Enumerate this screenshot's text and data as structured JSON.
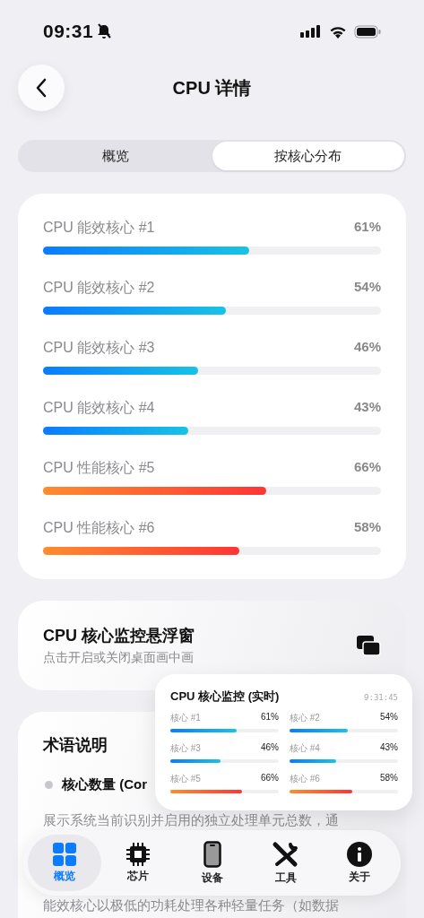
{
  "status_bar": {
    "time": "09:31"
  },
  "header": {
    "title": "CPU 详情"
  },
  "tabs": [
    {
      "label": "概览",
      "selected": false
    },
    {
      "label": "按核心分布",
      "selected": true
    }
  ],
  "cores": [
    {
      "name": "CPU 能效核心 #1",
      "reading": "61%",
      "level": 0.61,
      "kind": "efficiency"
    },
    {
      "name": "CPU 能效核心 #2",
      "reading": "54%",
      "level": 0.54,
      "kind": "efficiency"
    },
    {
      "name": "CPU 能效核心 #3",
      "reading": "46%",
      "level": 0.46,
      "kind": "efficiency"
    },
    {
      "name": "CPU 能效核心 #4",
      "reading": "43%",
      "level": 0.43,
      "kind": "efficiency"
    },
    {
      "name": "CPU 性能核心 #5",
      "reading": "66%",
      "level": 0.66,
      "kind": "performance"
    },
    {
      "name": "CPU 性能核心 #6",
      "reading": "58%",
      "level": 0.58,
      "kind": "performance"
    }
  ],
  "floating_window_card": {
    "title": "CPU 核心监控悬浮窗",
    "subtitle": "点击开启或关闭桌面画中画"
  },
  "glossary": {
    "title": "术语说明",
    "term": "核心数量 (Cor",
    "paragraph": "展示系统当前识别并启用的独立处理单元总数，通",
    "paragraph_2": "能效核心以极低的功耗处理各种轻量任务（如数据"
  },
  "monitor": {
    "title": "CPU 核心监控 (实时)",
    "time": "9:31:45",
    "cores": [
      {
        "name": "核心 #1",
        "reading": "61%",
        "level": 0.61,
        "kind": "efficiency"
      },
      {
        "name": "核心 #2",
        "reading": "54%",
        "level": 0.54,
        "kind": "efficiency"
      },
      {
        "name": "核心 #3",
        "reading": "46%",
        "level": 0.46,
        "kind": "efficiency"
      },
      {
        "name": "核心 #4",
        "reading": "43%",
        "level": 0.43,
        "kind": "efficiency"
      },
      {
        "name": "核心 #5",
        "reading": "66%",
        "level": 0.66,
        "kind": "performance"
      },
      {
        "name": "核心 #6",
        "reading": "58%",
        "level": 0.58,
        "kind": "performance"
      }
    ]
  },
  "tab_bar": [
    {
      "label": "概览",
      "kind": "overview",
      "selected": true
    },
    {
      "label": "芯片",
      "kind": "chip",
      "selected": false
    },
    {
      "label": "设备",
      "kind": "device",
      "selected": false
    },
    {
      "label": "工具",
      "kind": "tools",
      "selected": false
    },
    {
      "label": "关于",
      "kind": "about",
      "selected": false
    }
  ]
}
